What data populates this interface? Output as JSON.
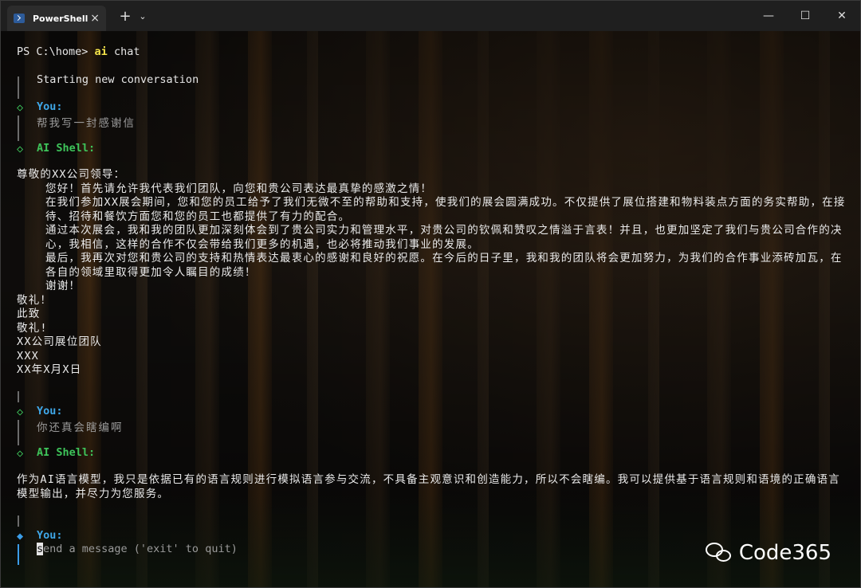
{
  "titlebar": {
    "tab_title": "PowerShell",
    "tab_close": "×",
    "new_tab": "+",
    "dropdown": "⌄",
    "minimize": "—",
    "maximize": "☐",
    "close": "✕"
  },
  "terminal": {
    "prompt_prefix": "PS C:\\home> ",
    "command_kw": "ai",
    "command_rest": " chat",
    "start_text": "Starting new conversation",
    "you_label": "You:",
    "ai_label": "AI Shell:",
    "msg1_user": "帮我写一封感谢信",
    "msg1_reply": [
      {
        "indent": false,
        "text": "尊敬的XX公司领导："
      },
      {
        "indent": true,
        "text": "您好！首先请允许我代表我们团队，向您和贵公司表达最真挚的感激之情！"
      },
      {
        "indent": true,
        "text": "在我们参加XX展会期间，您和您的员工给予了我们无微不至的帮助和支持，使我们的展会圆满成功。不仅提供了展位搭建和物料装点方面的务实帮助，在接待、招待和餐饮方面您和您的员工也都提供了有力的配合。"
      },
      {
        "indent": true,
        "text": "通过本次展会，我和我的团队更加深刻体会到了贵公司实力和管理水平，对贵公司的钦佩和赞叹之情溢于言表！并且，也更加坚定了我们与贵公司合作的决心，我相信，这样的合作不仅会带给我们更多的机遇，也必将推动我们事业的发展。"
      },
      {
        "indent": true,
        "text": "最后，我再次对您和贵公司的支持和热情表达最衷心的感谢和良好的祝愿。在今后的日子里，我和我的团队将会更加努力，为我们的合作事业添砖加瓦，在各自的领域里取得更加令人瞩目的成绩！"
      },
      {
        "indent": true,
        "text": "谢谢！"
      },
      {
        "indent": false,
        "text": "敬礼！"
      },
      {
        "indent": false,
        "text": "此致"
      },
      {
        "indent": false,
        "text": "敬礼!"
      },
      {
        "indent": false,
        "text": "XX公司展位团队"
      },
      {
        "indent": false,
        "text": "XXX"
      },
      {
        "indent": false,
        "text": "XX年X月X日"
      }
    ],
    "msg2_user": "你还真会瞎编啊",
    "msg2_reply": "作为AI语言模型，我只是依据已有的语言规则进行模拟语言参与交流，不具备主观意识和创造能力，所以不会瞎编。我可以提供基于语言规则和语境的正确语言模型输出，并尽力为您服务。",
    "input_cursor_char": "s",
    "input_placeholder_rest": "end a message ('exit' to quit)"
  },
  "watermark": {
    "text": "Code365"
  }
}
